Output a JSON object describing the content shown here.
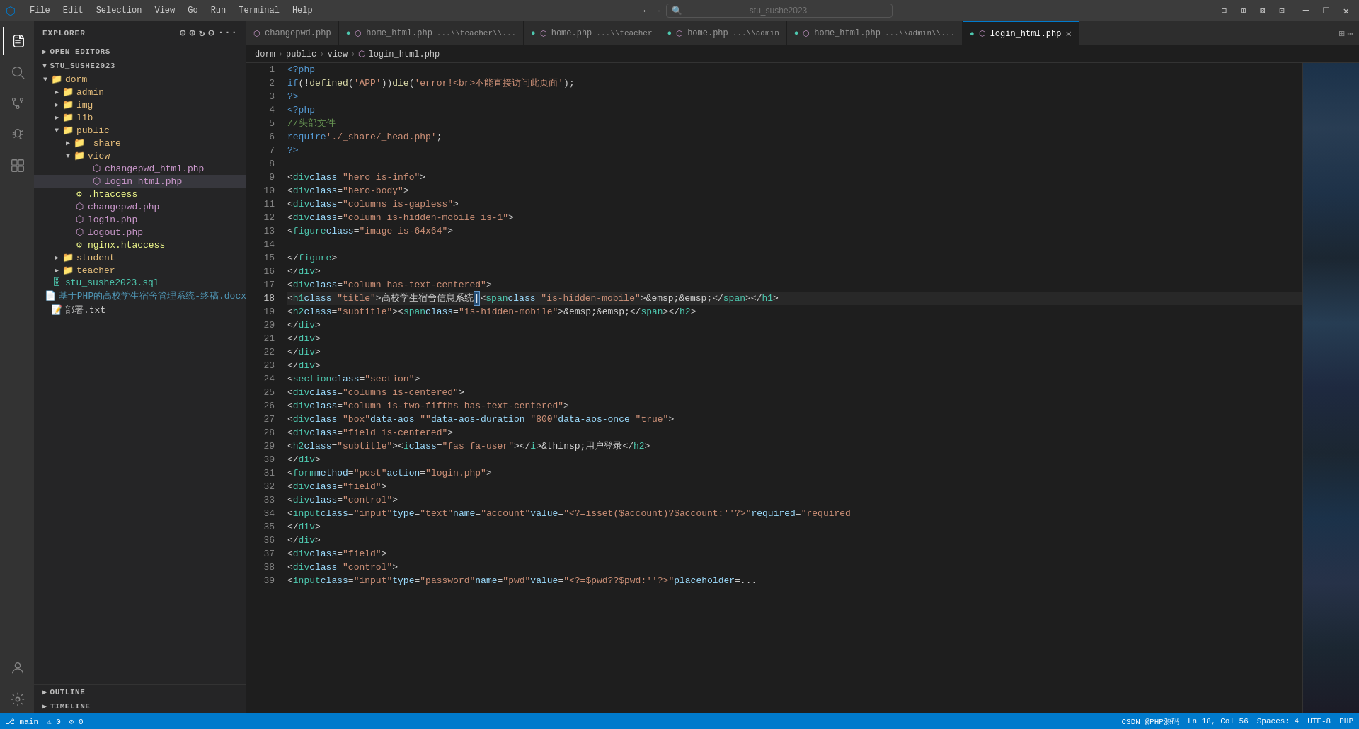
{
  "titlebar": {
    "menu_items": [
      "File",
      "Edit",
      "Selection",
      "View",
      "Go",
      "Run",
      "Terminal",
      "Help"
    ],
    "search_placeholder": "stu_sushe2023",
    "nav_back": "←",
    "nav_forward": "→",
    "window_controls": [
      "□□",
      "□",
      "□",
      "─",
      "□",
      "✕"
    ]
  },
  "activity_bar": {
    "items": [
      {
        "icon": "⊞",
        "name": "explorer",
        "active": true
      },
      {
        "icon": "⎇",
        "name": "source-control",
        "active": false
      },
      {
        "icon": "▷",
        "name": "run-debug",
        "active": false
      },
      {
        "icon": "⊡",
        "name": "extensions",
        "active": false
      },
      {
        "icon": "✦",
        "name": "copilot",
        "active": false
      }
    ],
    "bottom_items": [
      {
        "icon": "👤",
        "name": "account"
      },
      {
        "icon": "⚙",
        "name": "settings"
      }
    ]
  },
  "sidebar": {
    "title": "EXPLORER",
    "sections": {
      "open_editors": "OPEN EDITORS",
      "project": "STU_SUSHE2023"
    },
    "tree": [
      {
        "label": "dorm",
        "type": "folder",
        "depth": 1,
        "expanded": true
      },
      {
        "label": "admin",
        "type": "folder",
        "depth": 2,
        "expanded": false
      },
      {
        "label": "img",
        "type": "folder",
        "depth": 2,
        "expanded": false
      },
      {
        "label": "lib",
        "type": "folder",
        "depth": 2,
        "expanded": false
      },
      {
        "label": "public",
        "type": "folder",
        "depth": 2,
        "expanded": true
      },
      {
        "label": "_share",
        "type": "folder",
        "depth": 3,
        "expanded": false
      },
      {
        "label": "view",
        "type": "folder",
        "depth": 3,
        "expanded": true
      },
      {
        "label": "changepwd_html.php",
        "type": "php",
        "depth": 4
      },
      {
        "label": "login_html.php",
        "type": "php",
        "depth": 4,
        "active": true
      },
      {
        "label": ".htaccess",
        "type": "htaccess",
        "depth": 3
      },
      {
        "label": "changepwd.php",
        "type": "php",
        "depth": 3
      },
      {
        "label": "login.php",
        "type": "php",
        "depth": 3
      },
      {
        "label": "logout.php",
        "type": "php",
        "depth": 3
      },
      {
        "label": "nginx.htaccess",
        "type": "htaccess",
        "depth": 3
      },
      {
        "label": "student",
        "type": "folder",
        "depth": 2,
        "expanded": false
      },
      {
        "label": "teacher",
        "type": "folder",
        "depth": 2,
        "expanded": false
      },
      {
        "label": "stu_sushe2023.sql",
        "type": "sql",
        "depth": 1
      },
      {
        "label": "基于PHP的高校学生宿舍管理系统-终稿.docx",
        "type": "docx",
        "depth": 1
      },
      {
        "label": "部署.txt",
        "type": "txt",
        "depth": 1
      }
    ],
    "bottom_sections": [
      "OUTLINE",
      "TIMELINE"
    ]
  },
  "tabs": [
    {
      "label": "changepwd.php",
      "subtitle": "",
      "active": false,
      "icon": "●",
      "closeable": false
    },
    {
      "label": "home_html.php",
      "subtitle": "...\\teacher\\...",
      "active": false,
      "icon": "●",
      "closeable": false
    },
    {
      "label": "home.php",
      "subtitle": "...\\teacher",
      "active": false,
      "icon": "●",
      "closeable": false
    },
    {
      "label": "home.php",
      "subtitle": "...\\admin",
      "active": false,
      "icon": "●",
      "closeable": false
    },
    {
      "label": "home_html.php",
      "subtitle": "...\\admin\\...",
      "active": false,
      "icon": "●",
      "closeable": false
    },
    {
      "label": "login_html.php",
      "subtitle": "",
      "active": true,
      "icon": "●",
      "closeable": true
    }
  ],
  "breadcrumb": {
    "parts": [
      "dorm",
      ">",
      "public",
      ">",
      "view",
      ">",
      "login_html.php"
    ]
  },
  "code": {
    "lines": [
      {
        "num": 1,
        "content": "<?php"
      },
      {
        "num": 2,
        "content": "    if(!defined('APP')) die('error!<br>不能直接访问此页面');"
      },
      {
        "num": 3,
        "content": "?>"
      },
      {
        "num": 4,
        "content": "<?php"
      },
      {
        "num": 5,
        "content": "    //头部文件"
      },
      {
        "num": 6,
        "content": "    require './_share/_head.php';"
      },
      {
        "num": 7,
        "content": "?>"
      },
      {
        "num": 8,
        "content": ""
      },
      {
        "num": 9,
        "content": "<div class=\"hero is-info\">"
      },
      {
        "num": 10,
        "content": "    <div class=\"hero-body\">"
      },
      {
        "num": 11,
        "content": "        <div class=\"columns is-gapless\">"
      },
      {
        "num": 12,
        "content": "            <div class=\"column is-hidden-mobile is-1\">"
      },
      {
        "num": 13,
        "content": "                <figure class=\"image is-64x64\">"
      },
      {
        "num": 14,
        "content": ""
      },
      {
        "num": 15,
        "content": "                </figure>"
      },
      {
        "num": 16,
        "content": "            </div>"
      },
      {
        "num": 17,
        "content": "            <div class=\"column has-text-centered\">"
      },
      {
        "num": 18,
        "content": "                <h1 class=\"title\">高校学生宿舍信息系统<span class=\"is-hidden-mobile\">&emsp;&emsp;</span></h1>"
      },
      {
        "num": 19,
        "content": "                <h2 class=\"subtitle\"><span class=\"is-hidden-mobile\">&emsp;&emsp;</span></h2>"
      },
      {
        "num": 20,
        "content": "            </div>"
      },
      {
        "num": 21,
        "content": "        </div>"
      },
      {
        "num": 22,
        "content": "    </div>"
      },
      {
        "num": 23,
        "content": "</div>"
      },
      {
        "num": 24,
        "content": "<section class=\"section\">"
      },
      {
        "num": 25,
        "content": "    <div class=\"columns is-centered\">"
      },
      {
        "num": 26,
        "content": "        <div class=\"column is-two-fifths has-text-centered\">"
      },
      {
        "num": 27,
        "content": "            <div class=\"box\" data-aos=\"\" data-aos-duration=\"800\" data-aos-once=\"true\">"
      },
      {
        "num": 28,
        "content": "                <div class=\"field is-centered\">"
      },
      {
        "num": 29,
        "content": "                    <h2 class=\"subtitle\"><i class=\"fas fa-user\"></i>&thinsp;用户登录</h2>"
      },
      {
        "num": 30,
        "content": "                </div>"
      },
      {
        "num": 31,
        "content": "                <form method=\"post\" action=\"login.php\">"
      },
      {
        "num": 32,
        "content": "                    <div class=\"field\">"
      },
      {
        "num": 33,
        "content": "                        <div class=\"control\">"
      },
      {
        "num": 34,
        "content": "                            <input class=\"input\" type=\"text\" name=\"account\" value=\"<?=isset($account)?$account:''?>\" required=\"required"
      },
      {
        "num": 35,
        "content": "                        </div>"
      },
      {
        "num": 36,
        "content": "                    </div>"
      },
      {
        "num": 37,
        "content": "                <div class=\"field\">"
      },
      {
        "num": 38,
        "content": "                    <div class=\"control\">"
      },
      {
        "num": 39,
        "content": "                        <input class=\"input\" type=\"password\" name=\"pwd\" value=\"<?=$pwd??$pwd:''?>\" placeholder=..."
      }
    ]
  },
  "status_bar": {
    "left": [
      "⎇ main",
      "⚠ 0",
      "⊘ 0"
    ],
    "right": [
      "CSDN @PHP源码",
      "Ln 18, Col 56",
      "Spaces: 4",
      "UTF-8",
      "PHP"
    ]
  }
}
